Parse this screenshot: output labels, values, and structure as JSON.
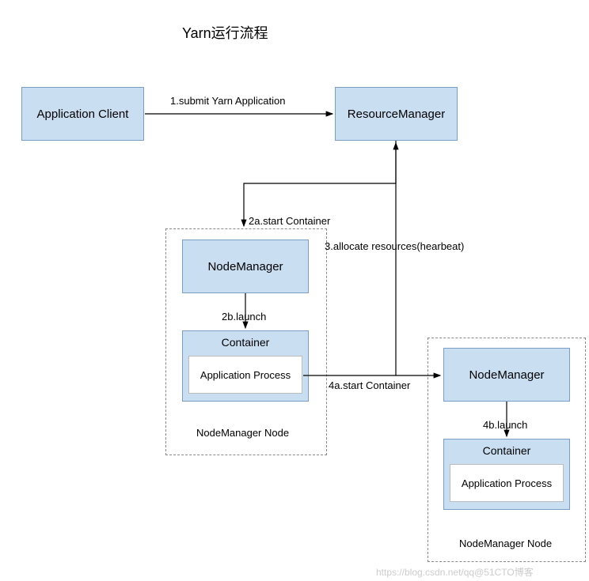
{
  "title": "Yarn运行流程",
  "boxes": {
    "app_client": "Application Client",
    "resource_manager": "ResourceManager",
    "node_manager_1": "NodeManager",
    "node_manager_2": "NodeManager",
    "container_1": "Container",
    "container_2": "Container",
    "app_process_1": "Application Process",
    "app_process_2": "Application Process"
  },
  "labels": {
    "step1": "1.submit Yarn Application",
    "step2a": "2a.start Container",
    "step2b": "2b.launch",
    "step3": "3.allocate resources(hearbeat)",
    "step4a": "4a.start Container",
    "step4b": "4b.launch",
    "nm_node_1": "NodeManager Node",
    "nm_node_2": "NodeManager Node"
  },
  "watermark": "https://blog.csdn.net/qq@51CTO博客"
}
